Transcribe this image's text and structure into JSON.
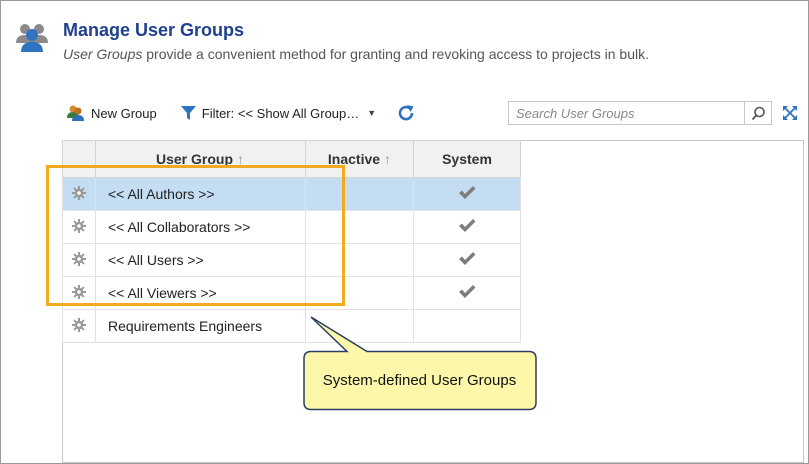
{
  "header": {
    "title": "Manage User Groups",
    "subtitle_em": "User Groups",
    "subtitle_rest": " provide a convenient method for granting and revoking access to projects in bulk."
  },
  "toolbar": {
    "new_group_label": "New Group",
    "filter_label": "Filter: << Show All Group…",
    "search_placeholder": "Search User Groups"
  },
  "table": {
    "columns": [
      "User Group",
      "Inactive",
      "System"
    ],
    "rows": [
      {
        "name": "<< All Authors >>",
        "inactive": "",
        "system": true,
        "selected": true
      },
      {
        "name": "<< All Collaborators >>",
        "inactive": "",
        "system": true,
        "selected": false
      },
      {
        "name": "<< All Users >>",
        "inactive": "",
        "system": true,
        "selected": false
      },
      {
        "name": "<< All Viewers >>",
        "inactive": "",
        "system": true,
        "selected": false
      },
      {
        "name": "Requirements Engineers",
        "inactive": "",
        "system": false,
        "selected": false
      }
    ]
  },
  "callout": {
    "text": "System-defined User Groups"
  },
  "colors": {
    "title": "#1f3f8f",
    "selected_row": "#c5ddf2",
    "highlight": "#f2ab1f",
    "callout_fill": "#fdf7a9"
  },
  "icons": [
    "users-group-icon",
    "new-group-icon",
    "filter-icon",
    "chevron-down-icon",
    "refresh-icon",
    "search-icon",
    "expand-icon",
    "gear-icon",
    "checkmark-icon"
  ]
}
